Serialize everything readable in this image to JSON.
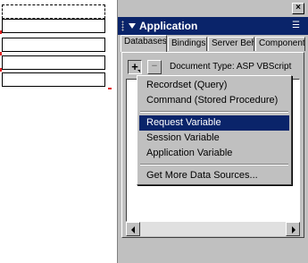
{
  "panel": {
    "title": "Application",
    "close": "×",
    "tabs": [
      "Databases",
      "Bindings",
      "Server Beh",
      "Component"
    ],
    "active_tab": "Databases",
    "document_type": "Document Type: ASP VBScript",
    "plus_label": "+",
    "minus_label": "−"
  },
  "menu": {
    "items": [
      "Recordset (Query)",
      "Command (Stored Procedure)",
      "Request Variable",
      "Session Variable",
      "Application Variable",
      "Get More Data Sources..."
    ],
    "selected": "Request Variable"
  },
  "colors": {
    "titlebar": "#0a246a",
    "selection": "#0a246a",
    "face": "#c0c0c0"
  }
}
